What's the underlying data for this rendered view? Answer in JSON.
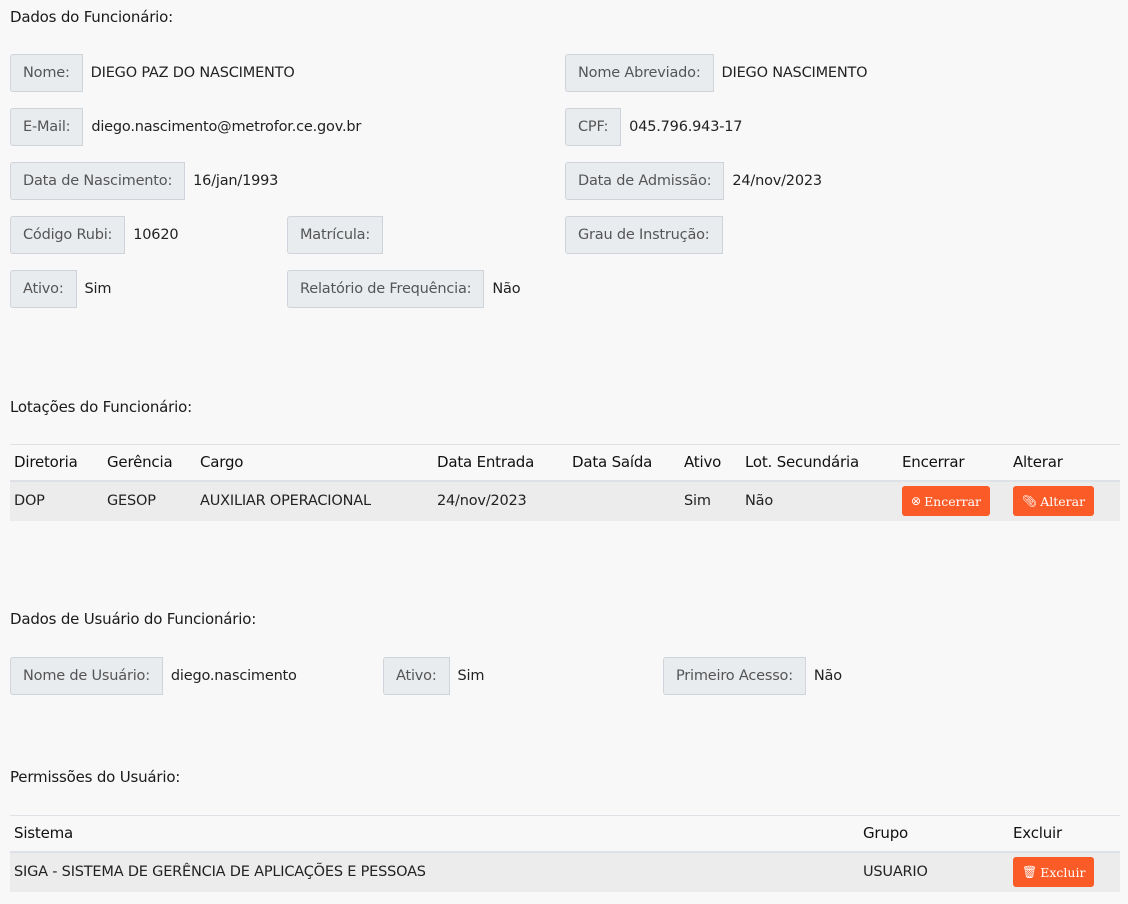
{
  "sections": {
    "dados_funcionario": "Dados do Funcionário:",
    "lotacoes": "Lotações do Funcionário:",
    "dados_usuario": "Dados de Usuário do Funcionário:",
    "permissoes": "Permissões do Usuário:"
  },
  "funcionario": {
    "nome_label": "Nome:",
    "nome": "DIEGO PAZ DO NASCIMENTO",
    "nome_abrev_label": "Nome Abreviado:",
    "nome_abrev": "DIEGO NASCIMENTO",
    "email_label": "E-Mail:",
    "email": "diego.nascimento@metrofor.ce.gov.br",
    "cpf_label": "CPF:",
    "cpf": "045.796.943-17",
    "nascimento_label": "Data de Nascimento:",
    "nascimento": "16/jan/1993",
    "admissao_label": "Data de Admissão:",
    "admissao": "24/nov/2023",
    "rubi_label": "Código Rubi:",
    "rubi": "10620",
    "matricula_label": "Matrícula:",
    "matricula": "",
    "grau_label": "Grau de Instrução:",
    "grau": "",
    "ativo_label": "Ativo:",
    "ativo": "Sim",
    "relatorio_label": "Relatório de Frequência:",
    "relatorio": "Não"
  },
  "lotacoes": {
    "headers": [
      "Diretoria",
      "Gerência",
      "Cargo",
      "Data Entrada",
      "Data Saída",
      "Ativo",
      "Lot. Secundária",
      "Encerrar",
      "Alterar"
    ],
    "rows": [
      {
        "diretoria": "DOP",
        "gerencia": "GESOP",
        "cargo": "AUXILIAR OPERACIONAL",
        "entrada": "24/nov/2023",
        "saida": "",
        "ativo": "Sim",
        "secundaria": "Não",
        "encerrar_label": "Encerrar",
        "alterar_label": "Alterar"
      }
    ]
  },
  "usuario": {
    "nome_label": "Nome de Usuário:",
    "nome": "diego.nascimento",
    "ativo_label": "Ativo:",
    "ativo": "Sim",
    "primeiro_label": "Primeiro Acesso:",
    "primeiro": "Não"
  },
  "permissoes": {
    "headers": [
      "Sistema",
      "Grupo",
      "Excluir"
    ],
    "rows": [
      {
        "sistema": "SIGA - SISTEMA DE GERÊNCIA DE APLICAÇÕES E PESSOAS",
        "grupo": "USUARIO",
        "excluir_label": "Excluir"
      }
    ]
  },
  "icons": {
    "encerrar": "times-circle-icon",
    "alterar": "paperclip-icon",
    "excluir": "trash-icon"
  },
  "colors": {
    "button": "#fb5b26",
    "label_bg": "#e9ecef"
  }
}
